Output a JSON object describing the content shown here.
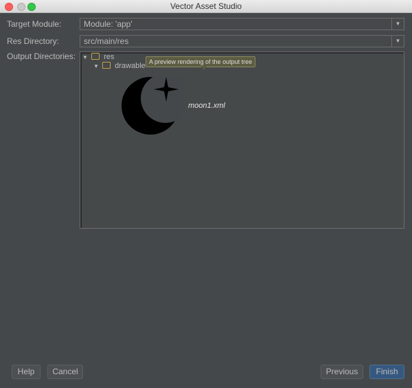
{
  "window": {
    "title": "Vector Asset Studio"
  },
  "form": {
    "target_module_label": "Target Module:",
    "target_module_value": "Module: 'app'",
    "res_directory_label": "Res Directory:",
    "res_directory_value": "src/main/res",
    "output_directories_label": "Output Directories:"
  },
  "tree": {
    "root": "res",
    "child": "drawable",
    "tooltip": "A preview rendering of the output tree",
    "file": "moon1.xml",
    "file_icon": "moon-star-icon"
  },
  "buttons": {
    "help": "Help",
    "cancel": "Cancel",
    "previous": "Previous",
    "finish": "Finish"
  },
  "colors": {
    "background": "#45484a",
    "accent": "#365880",
    "folder": "#c9a04a"
  }
}
